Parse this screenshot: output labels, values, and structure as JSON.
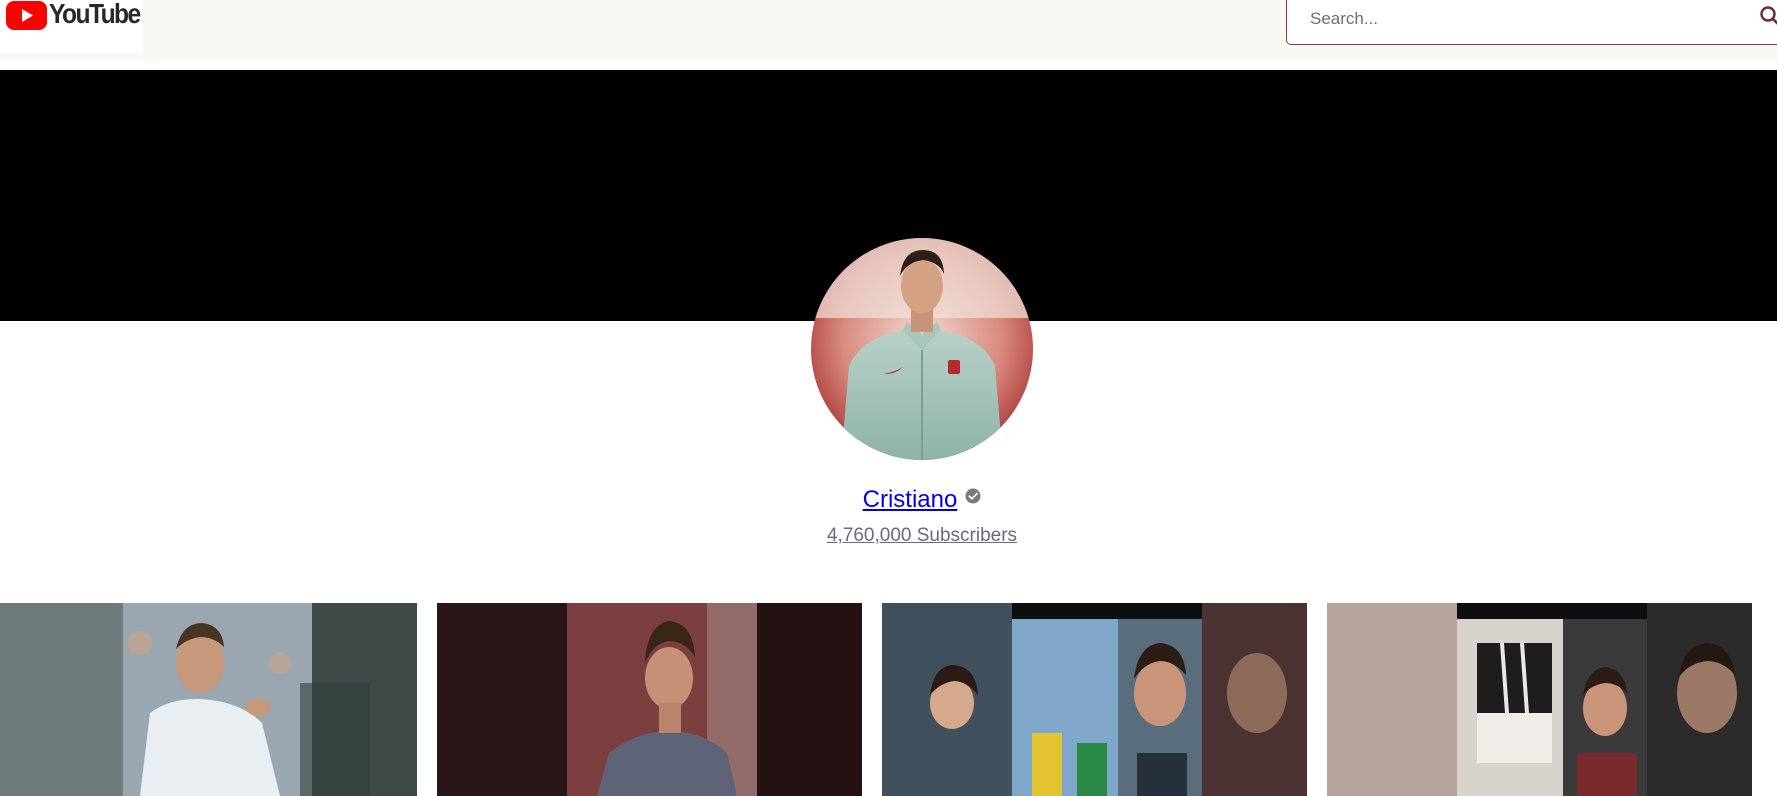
{
  "header": {
    "logo_text": "YouTube",
    "logo_icon": "youtube-play-icon",
    "brand_color": "#ff0000"
  },
  "search": {
    "placeholder": "Search...",
    "value": "",
    "icon": "search-icon"
  },
  "channel": {
    "name": "Cristiano",
    "verified_icon": "verified-check-icon",
    "subscribers": "4,760,000 Subscribers",
    "banner_color": "#000000"
  },
  "videos": [
    {
      "thumbnail": "video-thumbnail-1"
    },
    {
      "thumbnail": "video-thumbnail-2"
    },
    {
      "thumbnail": "video-thumbnail-3"
    },
    {
      "thumbnail": "video-thumbnail-4"
    }
  ]
}
